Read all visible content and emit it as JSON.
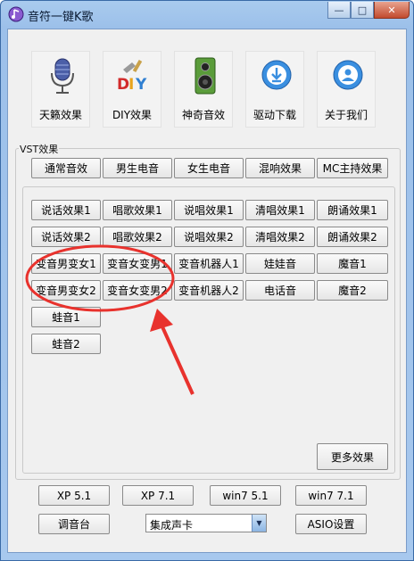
{
  "window": {
    "title": "音符一键K歌",
    "controls": [
      "—",
      "□",
      "✕"
    ]
  },
  "toolbar": [
    {
      "label": "天籁效果",
      "icon": "microphone-icon"
    },
    {
      "label": "DIY效果",
      "icon": "diy-icon"
    },
    {
      "label": "神奇音效",
      "icon": "speaker-icon"
    },
    {
      "label": "驱动下载",
      "icon": "download-icon"
    },
    {
      "label": "关于我们",
      "icon": "user-icon"
    }
  ],
  "vst": {
    "legend": "VST效果",
    "top_buttons": [
      "通常音效",
      "男生电音",
      "女生电音",
      "混响效果",
      "MC主持效果"
    ],
    "effects": [
      [
        "说话效果1",
        "唱歌效果1",
        "说唱效果1",
        "清唱效果1",
        "朗诵效果1"
      ],
      [
        "说话效果2",
        "唱歌效果2",
        "说唱效果2",
        "清唱效果2",
        "朗诵效果2"
      ],
      [
        "变音男变女1",
        "变音女变男1",
        "变音机器人1",
        "娃娃音",
        "魔音1"
      ],
      [
        "变音男变女2",
        "变音女变男2",
        "变音机器人2",
        "电话音",
        "魔音2"
      ],
      [
        "蛙音1"
      ],
      [
        "蛙音2"
      ]
    ],
    "more_button": "更多效果"
  },
  "bottom": {
    "os_buttons": [
      "XP 5.1",
      "XP 7.1",
      "win7 5.1",
      "win7 7.1"
    ],
    "mixer_button": "调音台",
    "soundcard": {
      "selected": "集成声卡"
    },
    "asio_button": "ASIO设置"
  },
  "colors": {
    "titlebar": "#9cc0ea",
    "annotation": "#e8322d"
  }
}
